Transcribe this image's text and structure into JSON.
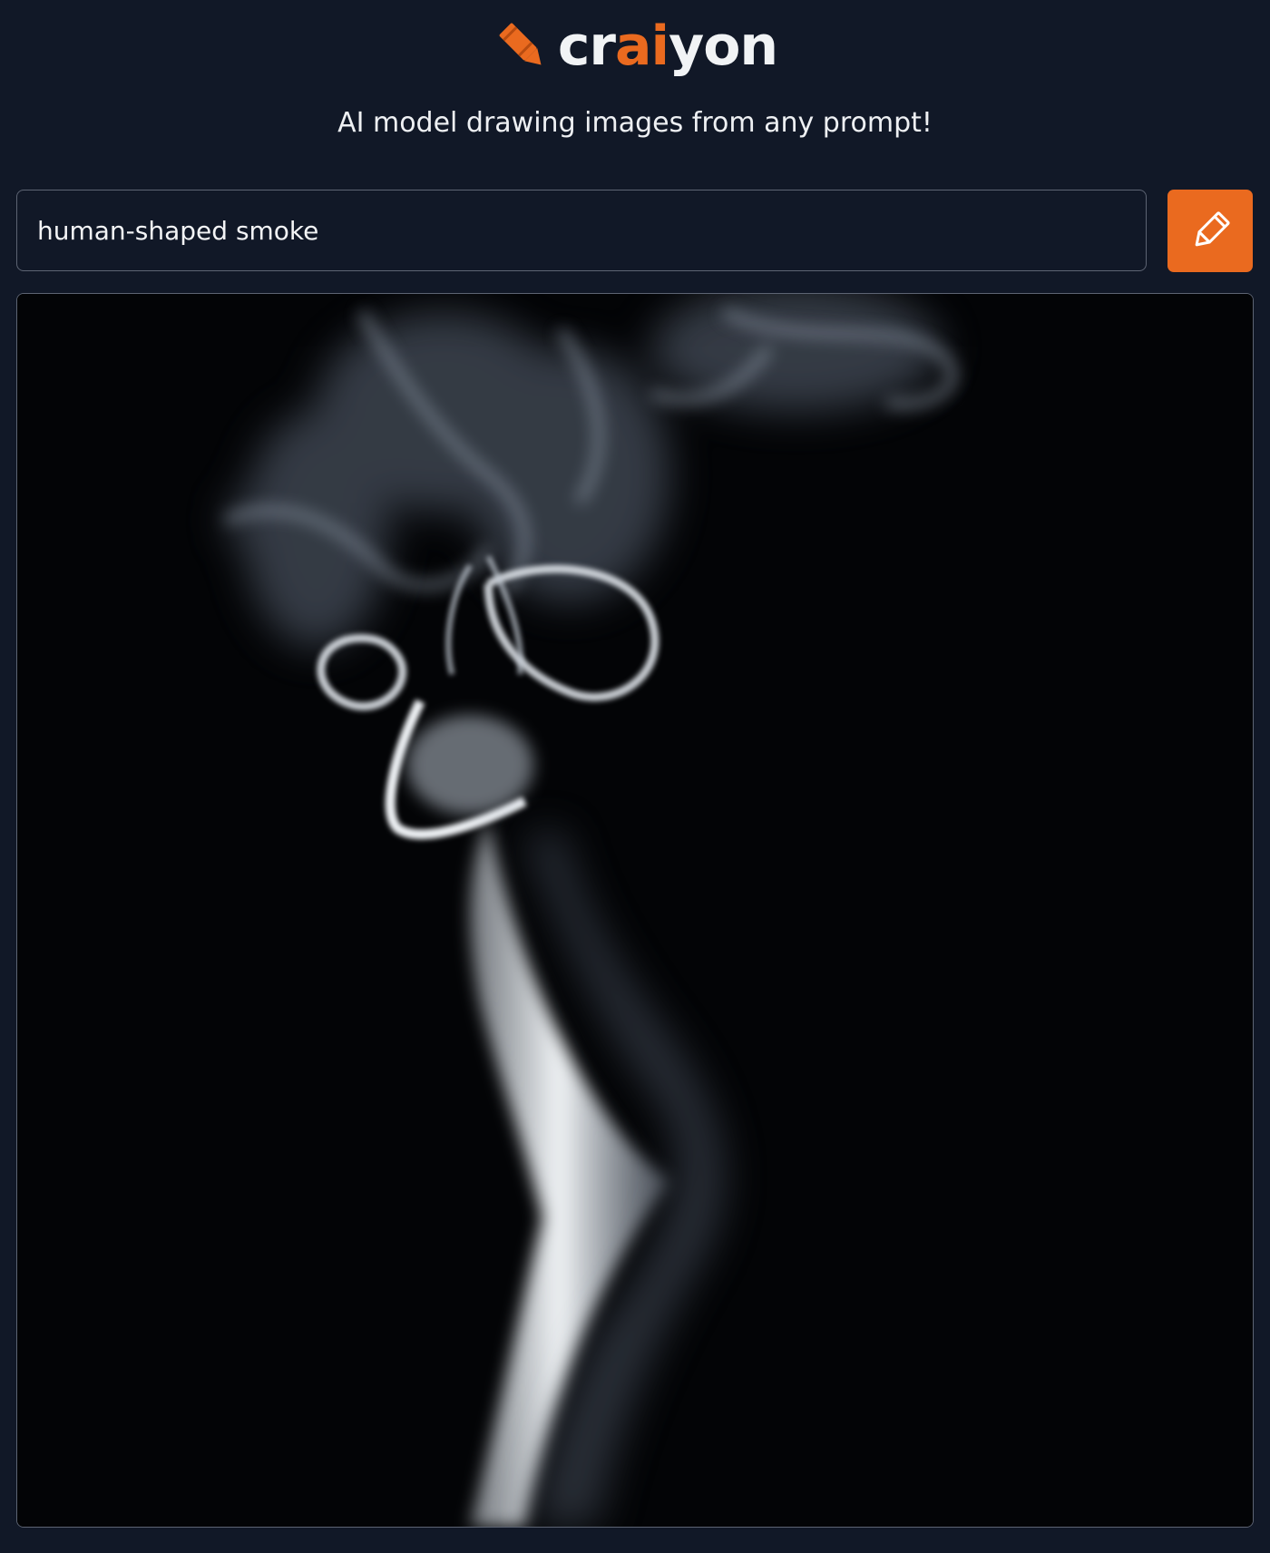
{
  "brand": {
    "name_prefix": "cr",
    "name_accent": "ai",
    "name_suffix": "yon",
    "logo_icon": "crayon-icon",
    "accent_color": "#ea6a1f"
  },
  "header": {
    "tagline": "AI model drawing images from any prompt!"
  },
  "prompt": {
    "value": "human-shaped smoke",
    "button_icon": "crayon-draw-icon"
  },
  "result": {
    "image_subject": "smoke"
  }
}
